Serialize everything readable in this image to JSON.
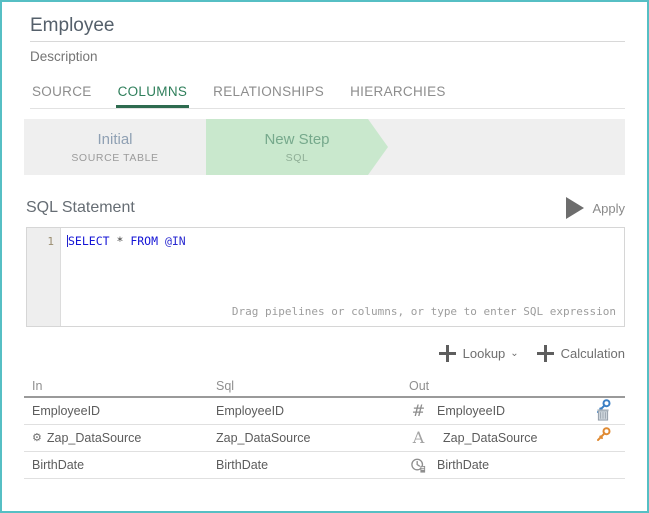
{
  "window": {
    "border_color": "#56bfc4"
  },
  "header": {
    "title_value": "Employee",
    "title_placeholder": "Name",
    "description_value": "",
    "description_placeholder": "Description"
  },
  "tabs": [
    {
      "label": "SOURCE",
      "active": false
    },
    {
      "label": "COLUMNS",
      "active": true
    },
    {
      "label": "RELATIONSHIPS",
      "active": false
    },
    {
      "label": "HIERARCHIES",
      "active": false
    }
  ],
  "steps": [
    {
      "name": "Initial",
      "subtitle": "SOURCE TABLE",
      "active": false
    },
    {
      "name": "New Step",
      "subtitle": "SQL",
      "active": true
    }
  ],
  "sql_section": {
    "title": "SQL Statement",
    "apply_label": "Apply",
    "apply_icon": "play-triangle-icon",
    "line_number": "1",
    "code": {
      "select_kw": "SELECT",
      "star": " * ",
      "from_kw": "FROM",
      "target": " @IN"
    },
    "hint": "Drag pipelines or columns, or type to enter SQL expression"
  },
  "actions": [
    {
      "label": "Lookup",
      "icon": "plus-icon",
      "has_caret": true,
      "caret": "⌄"
    },
    {
      "label": "Calculation",
      "icon": "plus-icon",
      "has_caret": false,
      "caret": ""
    }
  ],
  "table": {
    "headers": {
      "in": "In",
      "sql": "Sql",
      "out": "Out"
    },
    "rows": [
      {
        "in": "EmployeeID",
        "in_icon": "",
        "sql": "EmployeeID",
        "out": "EmployeeID",
        "out_type_icon": "number-icon",
        "out_type_glyph": "#",
        "row_icon": "primary-key-icon",
        "row_icon2": "trash-icon",
        "key_color": "#3b7fc4"
      },
      {
        "in": "Zap_DataSource",
        "in_icon": "gear-icon",
        "in_icon_glyph": "⚙",
        "sql": "Zap_DataSource",
        "out": "Zap_DataSource",
        "out_type_icon": "text-icon",
        "out_type_glyph": "A",
        "row_icon": "key-icon",
        "row_icon2": "",
        "key_color": "#e08a32"
      },
      {
        "in": "BirthDate",
        "in_icon": "",
        "sql": "BirthDate",
        "out": "BirthDate",
        "out_type_icon": "datetime-icon",
        "out_type_glyph": "",
        "row_icon": "",
        "row_icon2": "",
        "key_color": ""
      }
    ]
  },
  "colors": {
    "accent_teal": "#56bfc4",
    "tab_active": "#2f7f5b",
    "step_active_bg": "#c9e8cd",
    "strip_bg": "#efefef",
    "sql_keyword": "#1414d6"
  }
}
